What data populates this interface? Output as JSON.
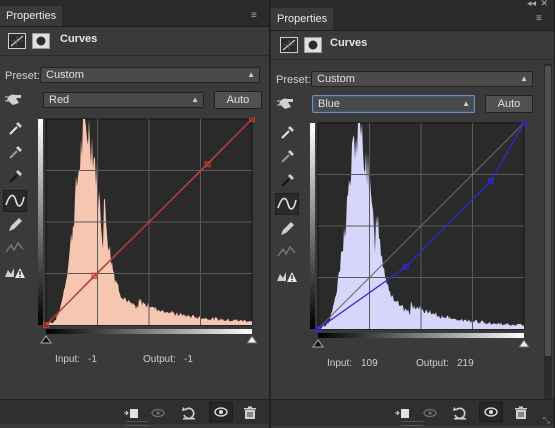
{
  "left_panel": {
    "tab_label": "Properties",
    "title": "Curves",
    "preset_label": "Preset:",
    "preset_value": "Custom",
    "channel_value": "Red",
    "auto_label": "Auto",
    "input_label": "Input:",
    "input_value": "-1",
    "output_label": "Output:",
    "output_value": "-1",
    "histogram_color": "#f6c6b0",
    "curve_color": "#c33b30"
  },
  "right_panel": {
    "tab_label": "Properties",
    "title": "Curves",
    "preset_label": "Preset:",
    "preset_value": "Custom",
    "channel_value": "Blue",
    "auto_label": "Auto",
    "input_label": "Input:",
    "input_value": "109",
    "output_label": "Output:",
    "output_value": "219",
    "histogram_color": "#d6d6fb",
    "curve_color": "#2b2bd0"
  },
  "tools": [
    "on-image-adjust-icon",
    "white-point-eyedropper-icon",
    "gray-point-eyedropper-icon",
    "black-point-eyedropper-icon",
    "curve-point-tool-icon",
    "pencil-tool-icon",
    "smooth-icon",
    "clipping-warning-icon"
  ],
  "footer_icons": [
    "clip-to-layer-icon",
    "view-previous-icon",
    "reset-icon",
    "visibility-eye-icon",
    "trash-icon"
  ]
}
